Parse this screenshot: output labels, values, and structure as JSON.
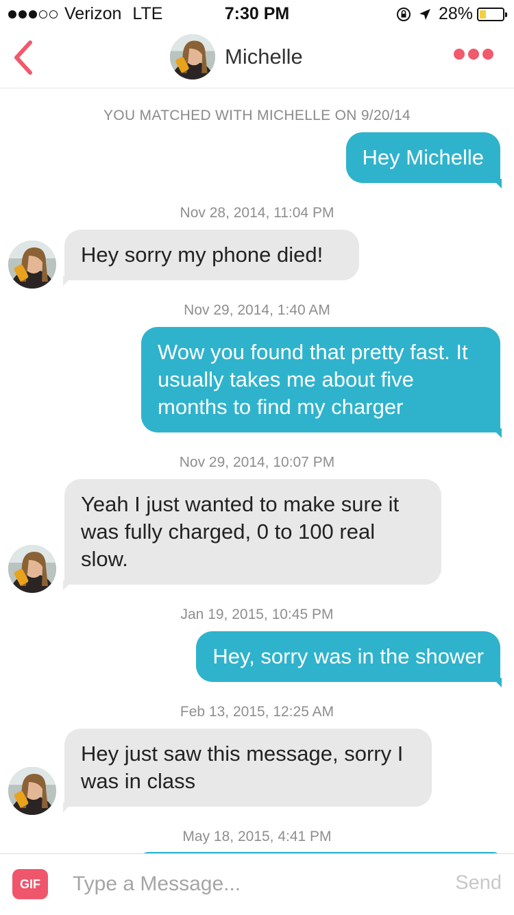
{
  "status_bar": {
    "carrier": "Verizon",
    "network": "LTE",
    "time": "7:30 PM",
    "battery": "28%",
    "battery_level": 0.28,
    "signal_bars": 3
  },
  "header": {
    "contact_name": "Michelle",
    "back_icon": "chevron-left-icon",
    "more_icon": "more-dots-icon"
  },
  "colors": {
    "accent": "#f05a6c",
    "outgoing_bubble": "#2fb3cc",
    "incoming_bubble": "#e8e8e8"
  },
  "thread": {
    "match_notice": "YOU MATCHED WITH MICHELLE ON 9/20/14",
    "messages": [
      {
        "from": "me",
        "text": "Hey Michelle"
      },
      {
        "timestamp": "Nov 28, 2014, 11:04 PM"
      },
      {
        "from": "them",
        "text": "Hey sorry my phone died!"
      },
      {
        "timestamp": "Nov 29, 2014, 1:40 AM"
      },
      {
        "from": "me",
        "text": "Wow you found that pretty fast. It usually takes me about  five months to find my charger"
      },
      {
        "timestamp": "Nov 29, 2014, 10:07 PM"
      },
      {
        "from": "them",
        "text": "Yeah I just wanted to make sure it was fully charged, 0 to 100 real slow."
      },
      {
        "timestamp": "Jan 19, 2015, 10:45 PM"
      },
      {
        "from": "me",
        "text": "Hey, sorry was in the shower"
      },
      {
        "timestamp": "Feb 13, 2015, 12:25 AM"
      },
      {
        "from": "them",
        "text": "Hey just saw this message, sorry I was in class"
      },
      {
        "timestamp": "May 18, 2015, 4:41 PM"
      }
    ]
  },
  "composer": {
    "gif_label": "GIF",
    "placeholder": "Type a Message...",
    "send_label": "Send"
  }
}
